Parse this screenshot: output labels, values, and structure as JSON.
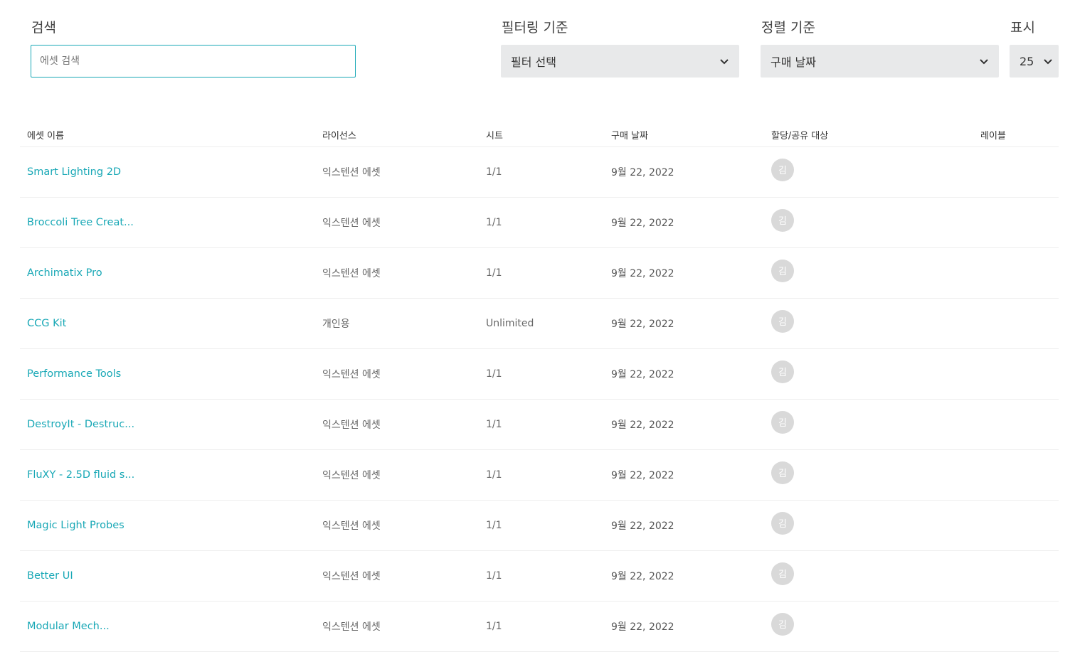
{
  "controls": {
    "search": {
      "label": "검색",
      "placeholder": "에셋 검색",
      "value": ""
    },
    "filter": {
      "label": "필터링 기준",
      "value": "필터 선택"
    },
    "sort": {
      "label": "정렬 기준",
      "value": "구매 날짜"
    },
    "display": {
      "label": "표시",
      "value": "25"
    }
  },
  "table": {
    "columns": [
      "에셋 이름",
      "라이선스",
      "시트",
      "구매 날짜",
      "할당/공유 대상",
      "레이블"
    ],
    "rows": [
      {
        "name": "Smart Lighting 2D",
        "license": "익스텐션 에셋",
        "seats": "1/1",
        "date": "9월 22, 2022",
        "assignee": "김",
        "label": ""
      },
      {
        "name": "Broccoli Tree Creat...",
        "license": "익스텐션 에셋",
        "seats": "1/1",
        "date": "9월 22, 2022",
        "assignee": "김",
        "label": ""
      },
      {
        "name": "Archimatix Pro",
        "license": "익스텐션 에셋",
        "seats": "1/1",
        "date": "9월 22, 2022",
        "assignee": "김",
        "label": ""
      },
      {
        "name": "CCG Kit",
        "license": "개인용",
        "seats": "Unlimited",
        "date": "9월 22, 2022",
        "assignee": "김",
        "label": ""
      },
      {
        "name": "Performance Tools",
        "license": "익스텐션 에셋",
        "seats": "1/1",
        "date": "9월 22, 2022",
        "assignee": "김",
        "label": ""
      },
      {
        "name": "DestroyIt - Destruc...",
        "license": "익스텐션 에셋",
        "seats": "1/1",
        "date": "9월 22, 2022",
        "assignee": "김",
        "label": ""
      },
      {
        "name": "FluXY - 2.5D fluid s...",
        "license": "익스텐션 에셋",
        "seats": "1/1",
        "date": "9월 22, 2022",
        "assignee": "김",
        "label": ""
      },
      {
        "name": "Magic Light Probes",
        "license": "익스텐션 에셋",
        "seats": "1/1",
        "date": "9월 22, 2022",
        "assignee": "김",
        "label": ""
      },
      {
        "name": "Better UI",
        "license": "익스텐션 에셋",
        "seats": "1/1",
        "date": "9월 22, 2022",
        "assignee": "김",
        "label": ""
      },
      {
        "name": "Modular Mech...",
        "license": "익스텐션 에셋",
        "seats": "1/1",
        "date": "9월 22, 2022",
        "assignee": "김",
        "label": ""
      }
    ]
  },
  "colors": {
    "accent": "#19a8b6",
    "select_bg": "#e8e9ea",
    "avatar_bg": "#d9d9d9"
  },
  "icons": {
    "dropdown": "chevron-down-icon"
  }
}
